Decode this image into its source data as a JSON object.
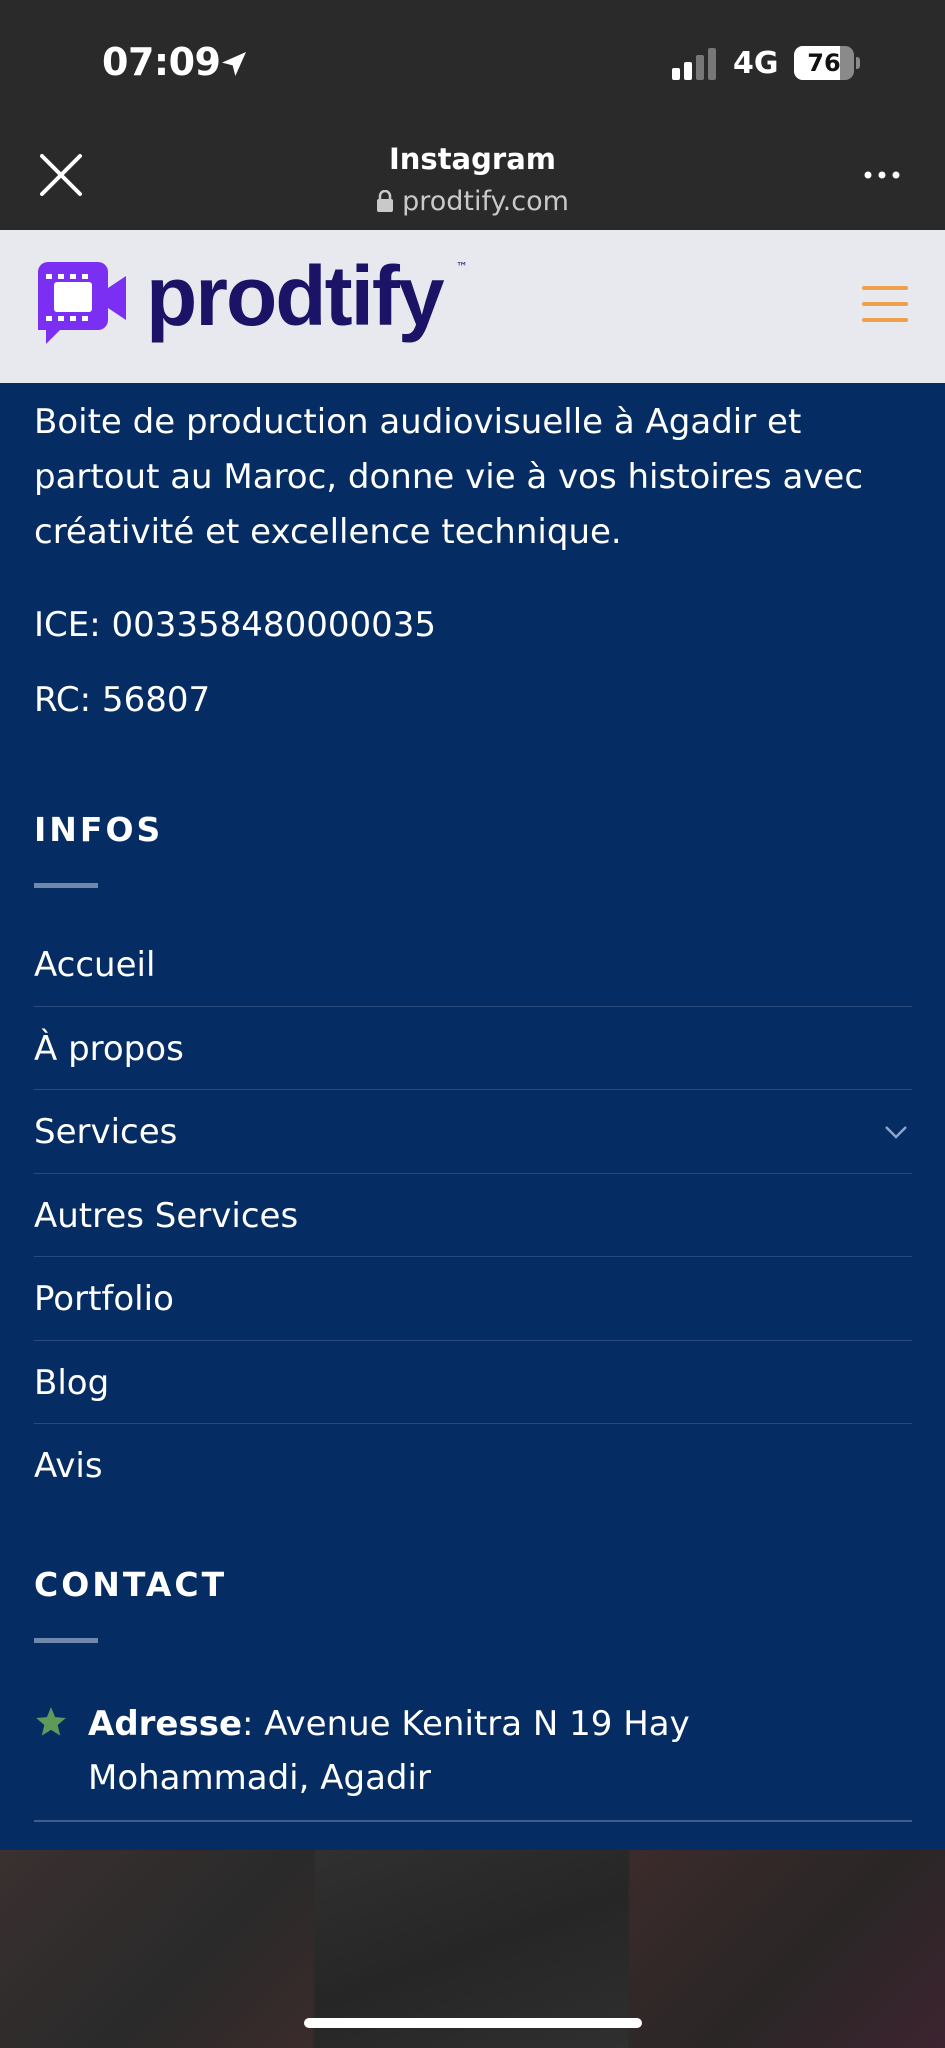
{
  "status_bar": {
    "time": "07:09",
    "network": "4G",
    "battery": "76",
    "battery_level": 0.76,
    "icons": [
      "location-arrow-icon",
      "signal-bars-icon",
      "battery-icon"
    ]
  },
  "browser": {
    "title": "Instagram",
    "url": "prodtify.com",
    "icons": [
      "close-icon",
      "lock-icon",
      "more-icon"
    ]
  },
  "site": {
    "logo_text": "prodtify",
    "logo_tm": "™",
    "accent_color": "#f0a04b",
    "brand_color": "#1b1466",
    "logo_icon_color": "#7b2ff2"
  },
  "footer": {
    "background_color": "#062d63",
    "description": "Boite de production audiovisuelle à Agadir et partout au Maroc, donne vie à vos histoires avec créativité et excellence technique.",
    "ice": "ICE: 003358480000035",
    "rc": "RC: 56807",
    "infos_title": "INFOS",
    "nav_items": [
      {
        "label": "Accueil"
      },
      {
        "label": "À propos"
      },
      {
        "label": "Services",
        "has_dropdown": true
      },
      {
        "label": "Autres Services"
      },
      {
        "label": "Portfolio"
      },
      {
        "label": "Blog"
      },
      {
        "label": "Avis"
      }
    ],
    "contact_title": "CONTACT",
    "address_label": "Adresse",
    "address_value": ": Avenue Kenitra N 19 Hay Mohammadi, Agadir",
    "address_icon": "star-icon",
    "star_color": "#5f9a5a"
  }
}
